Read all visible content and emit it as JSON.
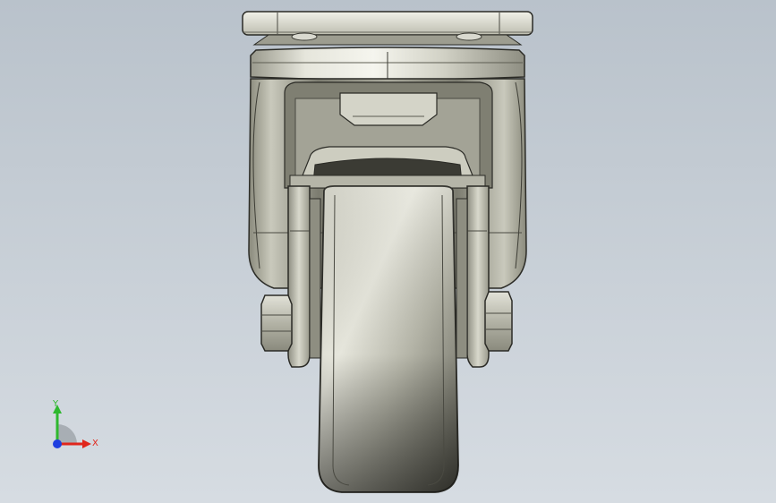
{
  "viewport": {
    "background_top": "#b9c2cb",
    "background_bottom": "#d6dce2"
  },
  "model": {
    "part_colors": {
      "metal_light": "#e8e8de",
      "metal_mid": "#b8b8aa",
      "metal_dark": "#6e6e62",
      "edge": "#2b2b26",
      "wheel_light": "#d9d9cd",
      "wheel_dark": "#5d5d52"
    }
  },
  "triad": {
    "x_label": "X",
    "y_label": "Y",
    "x_color": "#e0261c",
    "y_color": "#2eb82e",
    "z_color": "#1f3fe0"
  }
}
